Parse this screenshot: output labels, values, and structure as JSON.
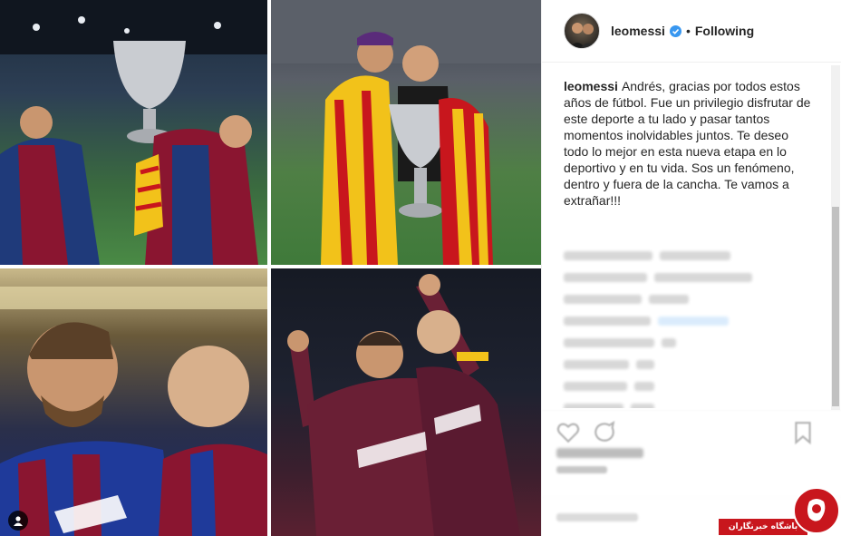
{
  "post": {
    "images": [
      {
        "name": "photo-champions-trophy-stadium"
      },
      {
        "name": "photo-trophy-with-flags"
      },
      {
        "name": "photo-celebration-close-up"
      },
      {
        "name": "photo-goal-celebration"
      }
    ]
  },
  "header": {
    "username": "leomessi",
    "separator": "•",
    "follow_state": "Following"
  },
  "caption": {
    "username": "leomessi",
    "text": "Andrés, gracias por todos estos años de fútbol. Fue un privilegio disfrutar de este deporte a tu lado y pasar tantos momentos inolvidables juntos. Te deseo todo lo mejor en esta nueva etapa en lo deportivo y en tu vida. Sos un fenómeno, dentro y fuera de la cancha. Te vamos a extrañar!!!"
  },
  "watermark": {
    "text": "باشگاه خبرنگاران"
  },
  "colors": {
    "verified": "#3897f0",
    "watermark_red": "#c8161d",
    "text": "#262626",
    "border": "#efefef"
  },
  "icons": [
    "verified-badge-icon",
    "heart-icon",
    "comment-icon",
    "bookmark-icon",
    "user-tag-icon"
  ]
}
